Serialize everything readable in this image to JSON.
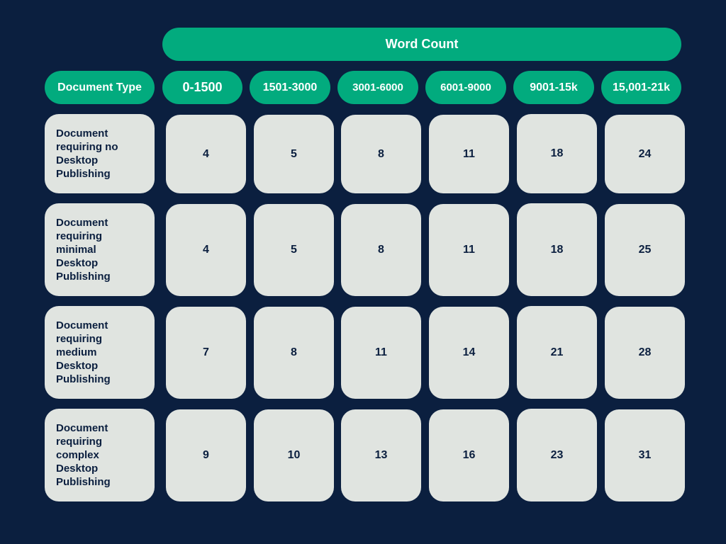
{
  "header": {
    "group_title": "Word Count",
    "row_header": "Document Type",
    "columns": [
      "0-1500",
      "1501-3000",
      "3001-6000",
      "6001-9000",
      "9001-15k",
      "15,001-21k"
    ]
  },
  "rows": [
    {
      "label": "Document requiring no Desktop Publishing",
      "values": [
        "4",
        "5",
        "8",
        "11",
        "18",
        "24"
      ]
    },
    {
      "label": "Document requiring minimal Desktop Publishing",
      "values": [
        "4",
        "5",
        "8",
        "11",
        "18",
        "25"
      ]
    },
    {
      "label": "Document requiring medium Desktop Publishing",
      "values": [
        "7",
        "8",
        "11",
        "14",
        "21",
        "28"
      ]
    },
    {
      "label": "Document requiring complex Desktop Publishing",
      "values": [
        "9",
        "10",
        "13",
        "16",
        "23",
        "31"
      ]
    }
  ],
  "colors": {
    "background": "#0b1f3f",
    "accent": "#02ab7e",
    "card": "#e0e4e0",
    "text_dark": "#0b1f3f",
    "text_light": "#ffffff"
  }
}
